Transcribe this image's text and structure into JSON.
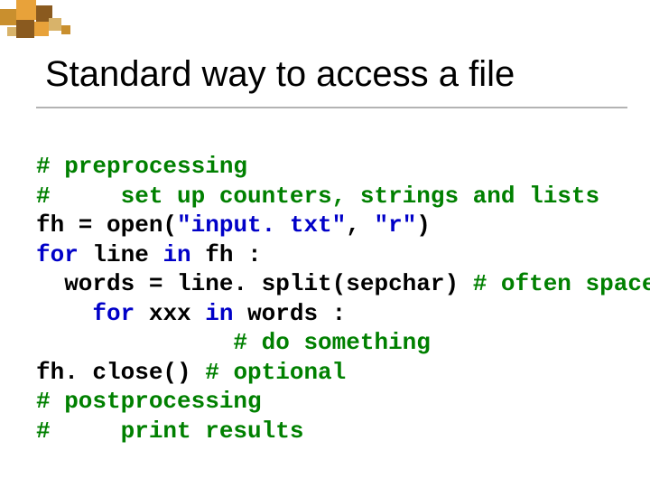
{
  "deco": {
    "colors": {
      "orange": "#e8a23a",
      "gold": "#c98f2e",
      "brown": "#8a5a1f",
      "tan": "#d8b36a"
    }
  },
  "title": "Standard way to access a file",
  "code": {
    "l1": "# preprocessing",
    "l2": "#     set up counters, strings and lists",
    "l3a": "fh = open(",
    "l3b": "\"input. txt\"",
    "l3c": ", ",
    "l3d": "\"r\"",
    "l3e": ")",
    "l4a": "for",
    "l4b": " line ",
    "l4c": "in",
    "l4d": " fh :",
    "l5a": "  words = line. split(sepchar) ",
    "l5b": "# often space",
    "l6a": "    ",
    "l6b": "for",
    "l6c": " xxx ",
    "l6d": "in",
    "l6e": " words :",
    "l7": "              # do something",
    "l8a": "fh. close() ",
    "l8b": "# optional",
    "l9": "# postprocessing",
    "l10": "#     print results"
  }
}
